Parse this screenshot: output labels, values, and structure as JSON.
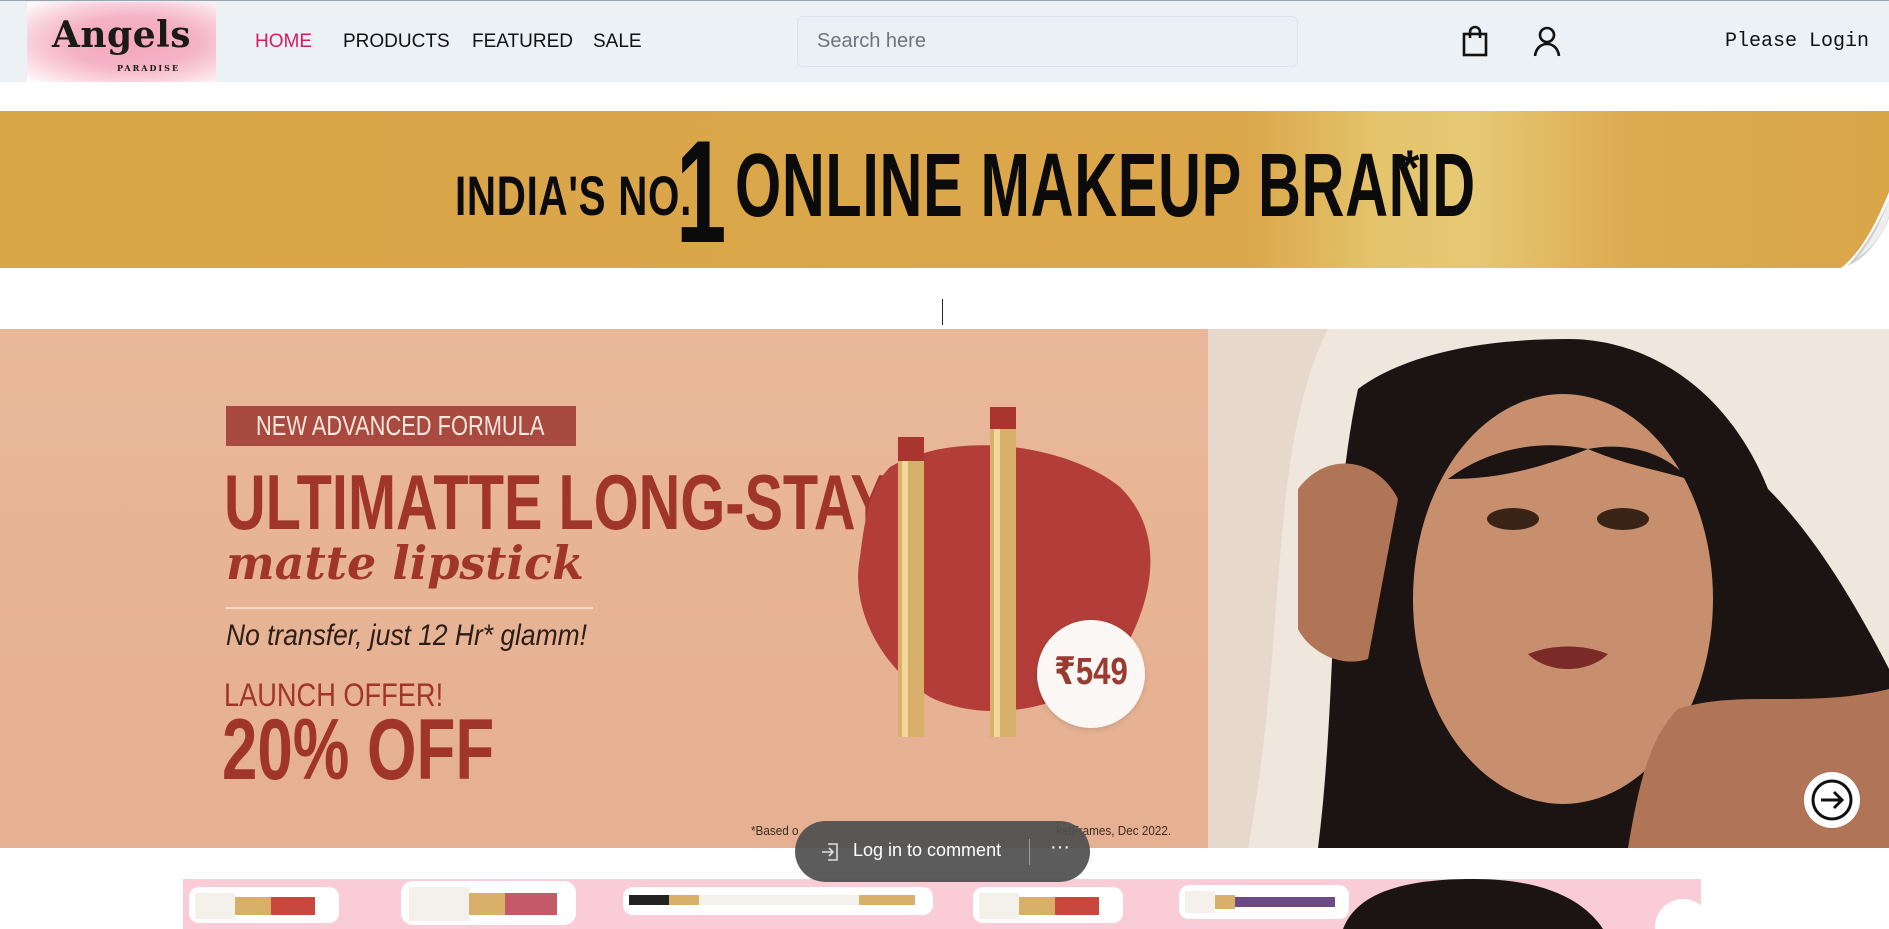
{
  "brand": {
    "name": "Angels",
    "tagline": "PARADISE"
  },
  "nav": {
    "home": "HOME",
    "products": "PRODUCTS",
    "featured": "FEATURED",
    "sale": "SALE",
    "active": "HOME"
  },
  "search": {
    "placeholder": "Search here",
    "value": ""
  },
  "header_icons": {
    "cart": "shopping-bag-icon",
    "account": "user-icon"
  },
  "account": {
    "login_label": "Please Login"
  },
  "top_banner": {
    "prefix": "INDIA'S NO.",
    "number": "1",
    "suffix": "ONLINE MAKEUP BRAND",
    "asterisk": "*"
  },
  "hero": {
    "tag": "NEW ADVANCED FORMULA",
    "headline": "ULTIMATTE LONG-STAY",
    "subhead": "matte lipstick",
    "tagline": "No transfer, just 12 Hr* glamm!",
    "offer": "LAUNCH OFFER!",
    "discount": "20% OFF",
    "price": "₹549",
    "footnote_left": "*Based o",
    "footnote_right": "ketFrames, Dec 2022.",
    "next_icon": "arrow-right-icon"
  },
  "comment_pill": {
    "login_label": "Log in to comment",
    "more": "···"
  },
  "colors": {
    "accent": "#d81b5e",
    "header_bg": "#ecf1f5",
    "banner_gold": "#d9a648",
    "hero_red": "#a0352c",
    "hero_bg": "#e8b395"
  }
}
